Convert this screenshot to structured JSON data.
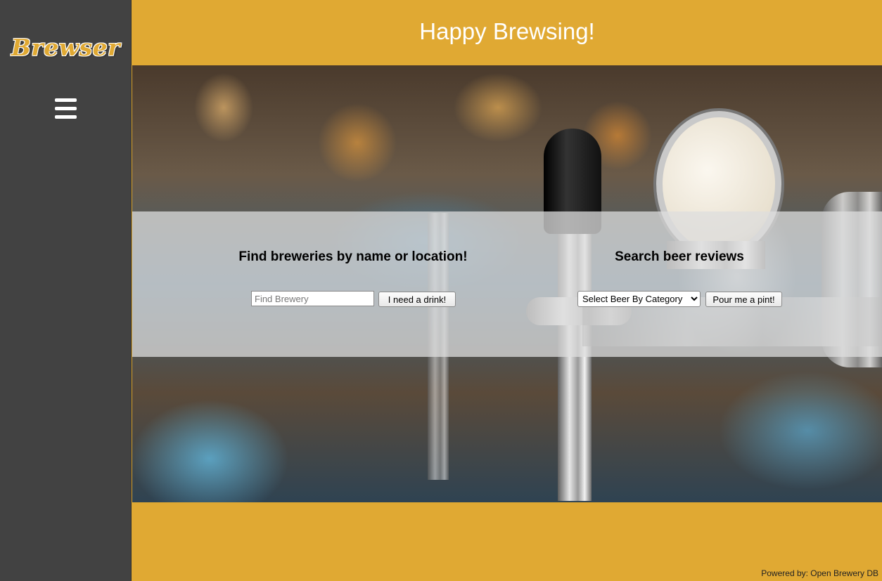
{
  "sidebar": {
    "logo_text": "Brewser",
    "menu_icon": "hamburger-menu-icon"
  },
  "header": {
    "title": "Happy Brewsing!"
  },
  "brewery_search": {
    "heading": "Find breweries by name or location!",
    "input_placeholder": "Find Brewery",
    "input_value": "",
    "button_label": "I need a drink!"
  },
  "beer_search": {
    "heading": "Search beer reviews",
    "select_value": "Select Beer By Category",
    "button_label": "Pour me a pint!"
  },
  "footer": {
    "powered_by": "Powered by: Open Brewery DB"
  },
  "colors": {
    "accent": "#e0a933",
    "sidebar": "#424242",
    "panel": "rgba(222,222,222,0.75)"
  }
}
